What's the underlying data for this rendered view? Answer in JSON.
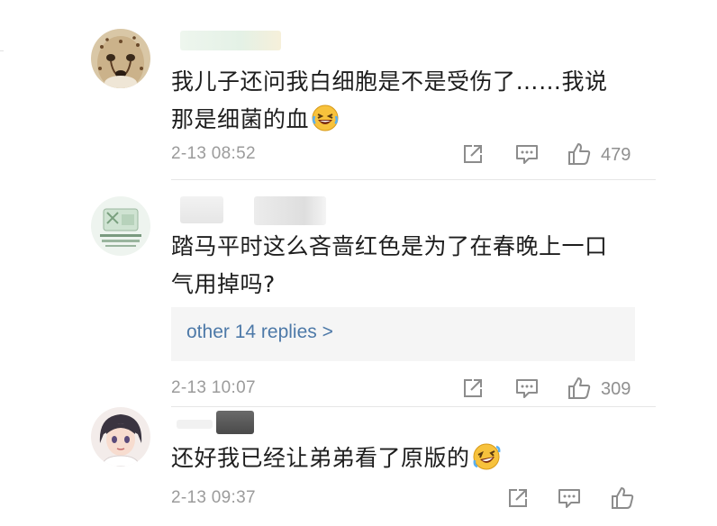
{
  "comments": [
    {
      "text_line1": "我儿子还问我白细胞是不是受伤了……我说",
      "text_line2": "那是细菌的血",
      "emoji": "grinning-squinting-laugh-emoji",
      "time": "2-13 08:52",
      "likes": "479"
    },
    {
      "text_line1": "踏马平时这么吝啬红色是为了在春晚上一口",
      "text_line2": "气用掉吗?",
      "replies_label": "other 14 replies >",
      "time": "2-13 10:07",
      "likes": "309"
    },
    {
      "text_line1": "还好我已经让弟弟看了原版的",
      "emoji": "rolling-laugh-emoji",
      "time": "2-13 09:37",
      "likes": ""
    }
  ],
  "icons": {
    "share": "share-out-icon",
    "reply": "comment-bubble-icon",
    "like": "thumbs-up-icon"
  },
  "colors": {
    "link": "#4d79a8",
    "meta": "#9b9b9b",
    "reply_box": "#f5f5f5"
  }
}
